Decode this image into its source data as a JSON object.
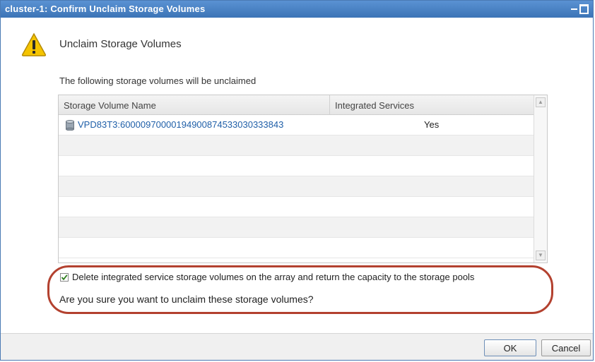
{
  "window": {
    "title": "cluster-1: Confirm Unclaim Storage Volumes"
  },
  "header": {
    "icon": "warning-icon",
    "text": "Unclaim Storage Volumes"
  },
  "description": "The following storage volumes will be unclaimed",
  "table": {
    "columns": [
      "Storage Volume Name",
      "Integrated Services"
    ],
    "rows": [
      {
        "name": "VPD83T3:60000970000194900874533030333843",
        "integrated_services": "Yes",
        "icon": "storage-volume-icon"
      }
    ]
  },
  "options": {
    "delete_checkbox": {
      "checked": true,
      "label": "Delete integrated service storage volumes on the array and return the capacity to the storage pools"
    }
  },
  "confirm_text": "Are you sure you want to unclaim these storage volumes?",
  "buttons": {
    "ok": "OK",
    "cancel": "Cancel"
  },
  "colors": {
    "titlebar": "#3c74b6",
    "link": "#1f5fa8",
    "highlight_border": "#b3412f",
    "warning": "#f5c400"
  }
}
